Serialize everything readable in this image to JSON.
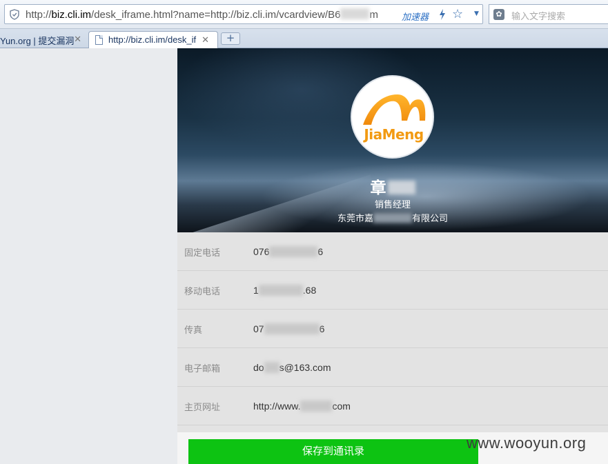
{
  "browser": {
    "url_prefix": "http://",
    "url_domain": "biz.cli.im",
    "url_rest": "/desk_iframe.html?name=http://biz.cli.im/vcardview/B6",
    "url_tail": "m",
    "accelerator_label": "加速器",
    "search_placeholder": "输入文字搜索"
  },
  "tabs": [
    {
      "title": "Yun.org | 提交漏洞"
    },
    {
      "title": "http://biz.cli.im/desk_if"
    }
  ],
  "card": {
    "logo_text": "JiaMeng",
    "name_visible": "章",
    "position": "销售经理",
    "company_prefix": "东莞市嘉",
    "company_suffix": "有限公司",
    "fields": [
      {
        "label": "固定电话",
        "value_start": "076",
        "value_end": "6"
      },
      {
        "label": "移动电话",
        "value_start": "1",
        "value_end": ".68"
      },
      {
        "label": "传真",
        "value_start": "07",
        "value_end": "6"
      },
      {
        "label": "电子邮箱",
        "value_start": "do",
        "value_end": "s@163.com"
      },
      {
        "label": "主页网址",
        "value_start": "http://www.",
        "value_end": "com"
      }
    ],
    "save_label": "保存到通讯录"
  },
  "watermark": "www.wooyun.org",
  "colors": {
    "accent_green": "#0dc312",
    "link_blue": "#2b6fc4",
    "logo_orange": "#f29a12"
  }
}
